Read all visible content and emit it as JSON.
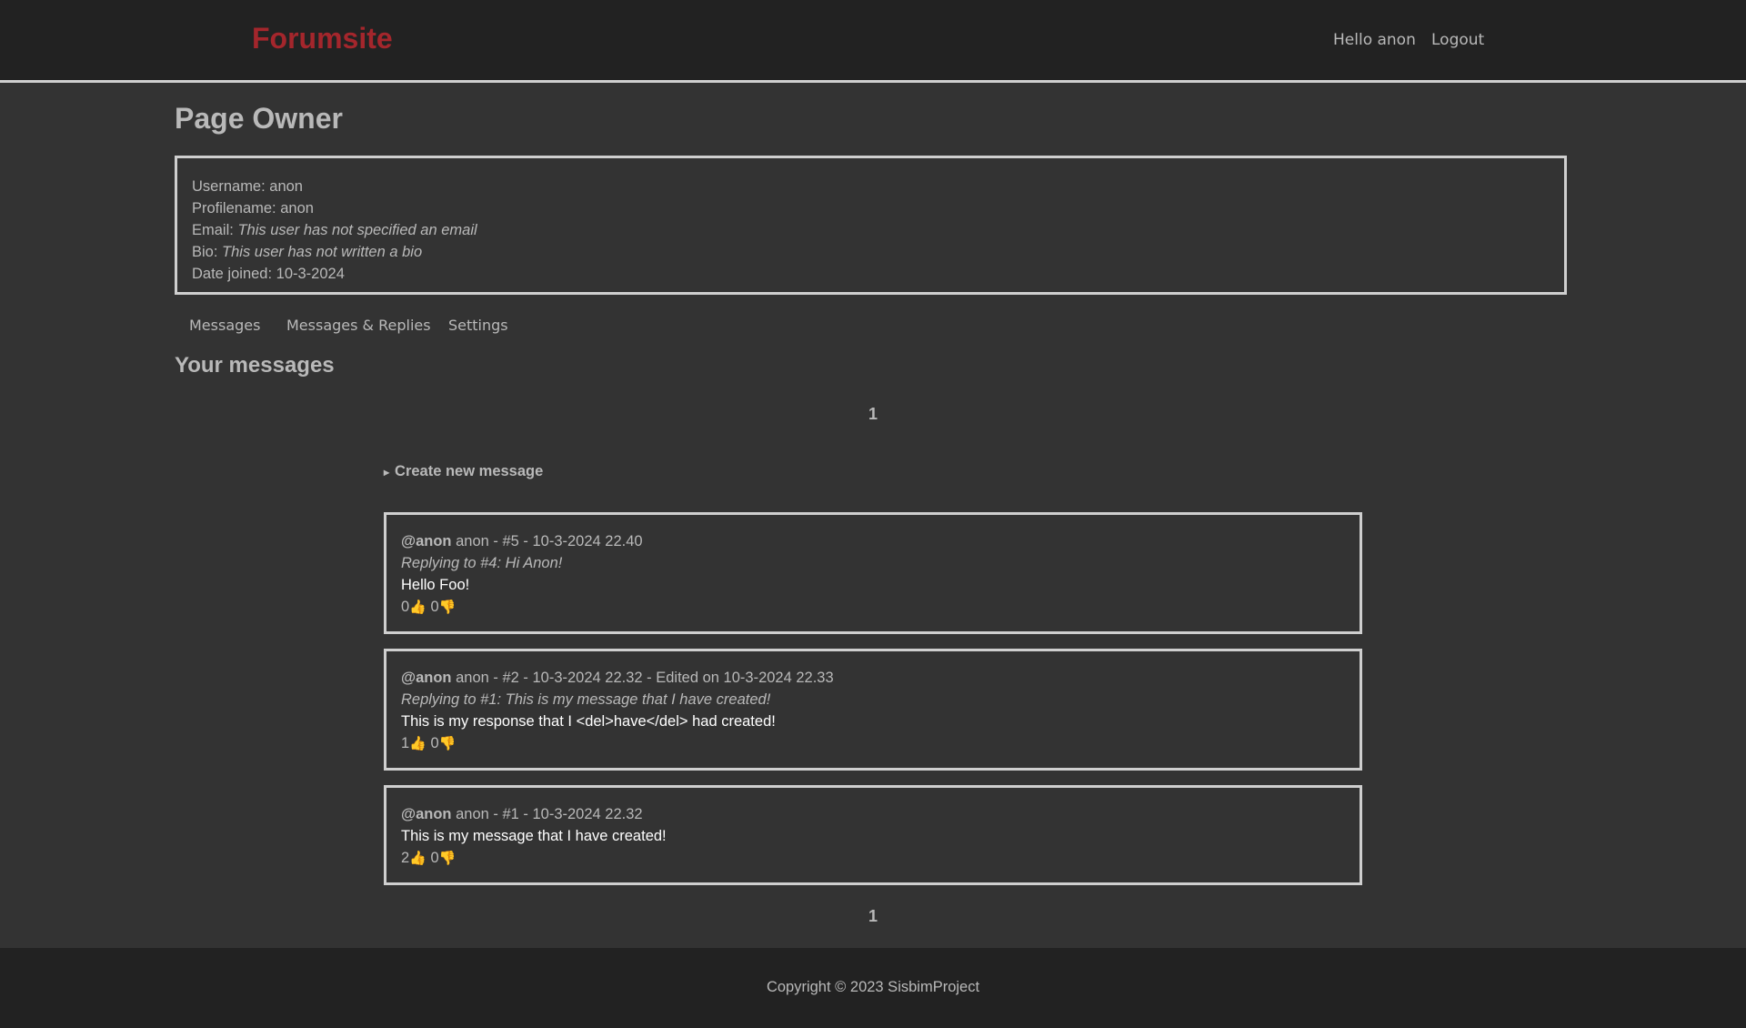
{
  "header": {
    "logo": "Forumsite",
    "greeting": "Hello anon",
    "logout": "Logout"
  },
  "page_title": "Page Owner",
  "profile": {
    "username_label": "Username: ",
    "username": "anon",
    "profilename_label": "Profilename: ",
    "profilename": "anon",
    "email_label": "Email: ",
    "email": "This user has not specified an email",
    "bio_label": "Bio: ",
    "bio": "This user has not written a bio",
    "joined_label": "Date joined: ",
    "joined": "10-3-2024"
  },
  "tabs": [
    "Messages",
    "Messages & Replies",
    "Settings"
  ],
  "section_title": "Your messages",
  "pager": {
    "top": "1",
    "bottom": "1"
  },
  "create_message": {
    "arrow": "▸",
    "label": "Create new message"
  },
  "icons": {
    "like": "👍",
    "dislike": "👎"
  },
  "messages": [
    {
      "handle": "@anon",
      "meta": " anon - #5 - 10-3-2024 22.40",
      "reply": "Replying to #4: Hi Anon!",
      "body": "Hello Foo!",
      "likes": "0",
      "dislikes": "0"
    },
    {
      "handle": "@anon",
      "meta": " anon - #2 - 10-3-2024 22.32 - Edited on 10-3-2024 22.33",
      "reply": "Replying to #1: This is my message that I have created!",
      "body": "This is my response that I <del>have</del> had created!",
      "likes": "1",
      "dislikes": "0"
    },
    {
      "handle": "@anon",
      "meta": " anon - #1 - 10-3-2024 22.32",
      "body": "This is my message that I have created!",
      "likes": "2",
      "dislikes": "0"
    }
  ],
  "footer": "Copyright © 2023 SisbimProject",
  "colors": {
    "background": "#333333",
    "header": "#222222",
    "brand": "#a4262c",
    "border": "#cfcfcf",
    "text": "#b9b9b9"
  }
}
